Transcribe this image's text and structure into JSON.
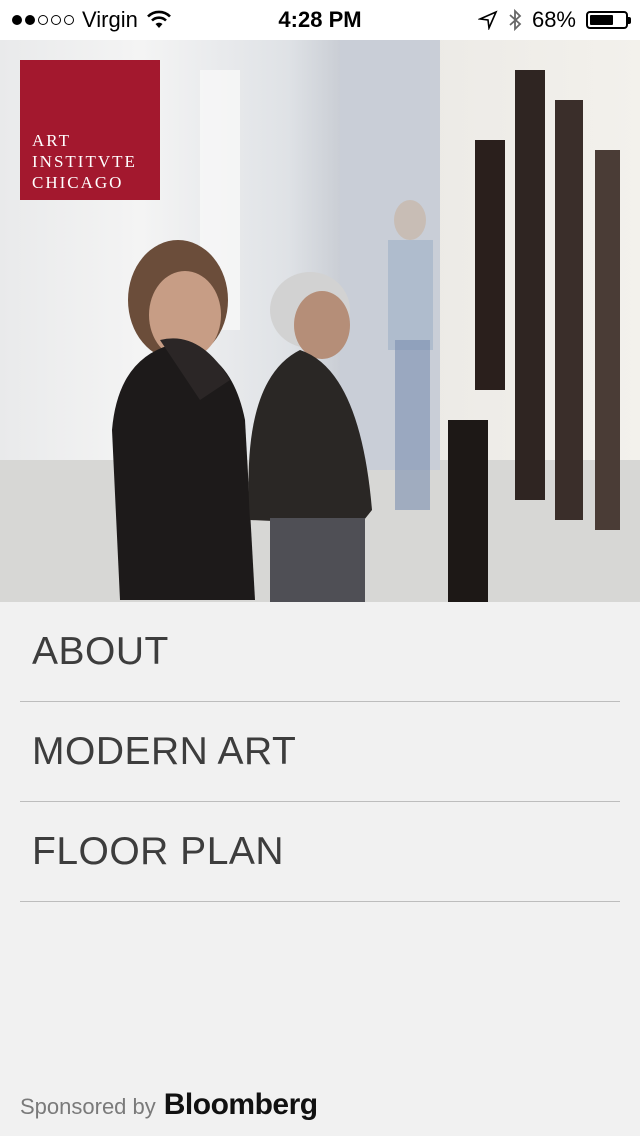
{
  "status_bar": {
    "carrier": "Virgin",
    "time": "4:28 PM",
    "battery": "68%",
    "battery_level": 0.68,
    "signal_bars": 2,
    "signal_total": 5
  },
  "logo": {
    "line1": "ART",
    "line2": "INSTITVTE",
    "line3": "CHICAGO"
  },
  "nav": {
    "items": [
      {
        "label": "ABOUT"
      },
      {
        "label": "MODERN ART"
      },
      {
        "label": "FLOOR PLAN"
      }
    ]
  },
  "sponsor": {
    "prefix": "Sponsored by",
    "brand": "Bloomberg"
  },
  "colors": {
    "logo_bg": "#a3182e",
    "background": "#f1f1f1",
    "text": "#3d3d3d"
  }
}
